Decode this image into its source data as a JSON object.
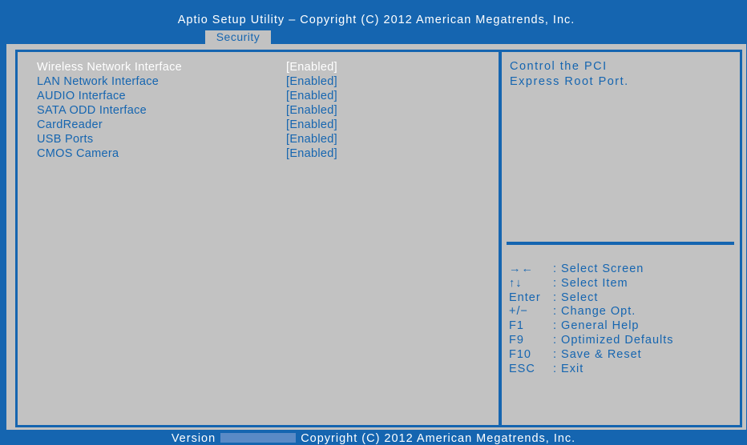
{
  "header": {
    "title": "Aptio Setup Utility – Copyright (C) 2012 American Megatrends, Inc.",
    "active_tab": "Security"
  },
  "menu": {
    "items": [
      {
        "label": "Wireless Network Interface",
        "value": "[Enabled]",
        "selected": true
      },
      {
        "label": "LAN Network Interface",
        "value": "[Enabled]",
        "selected": false
      },
      {
        "label": "AUDIO Interface",
        "value": "[Enabled]",
        "selected": false
      },
      {
        "label": "SATA ODD Interface",
        "value": "[Enabled]",
        "selected": false
      },
      {
        "label": "CardReader",
        "value": "[Enabled]",
        "selected": false
      },
      {
        "label": "USB Ports",
        "value": "[Enabled]",
        "selected": false
      },
      {
        "label": "CMOS Camera",
        "value": "[Enabled]",
        "selected": false
      }
    ]
  },
  "help": {
    "lines": [
      "Control the PCI",
      "Express Root Port."
    ]
  },
  "keys": [
    {
      "key": "→←",
      "desc": ": Select Screen"
    },
    {
      "key": "↑↓",
      "desc": ": Select Item"
    },
    {
      "key": "Enter",
      "desc": ": Select"
    },
    {
      "key": "+/−",
      "desc": ": Change Opt."
    },
    {
      "key": "F1",
      "desc": ": General Help"
    },
    {
      "key": "F9",
      "desc": ": Optimized Defaults"
    },
    {
      "key": "F10",
      "desc": ": Save & Reset"
    },
    {
      "key": "ESC",
      "desc": ": Exit"
    }
  ],
  "footer": {
    "version_label": "Version",
    "copyright": "Copyright (C) 2012 American Megatrends, Inc."
  },
  "colors": {
    "accent": "#1565b0",
    "panel": "#c2c2c2",
    "highlight": "#ffffff"
  }
}
